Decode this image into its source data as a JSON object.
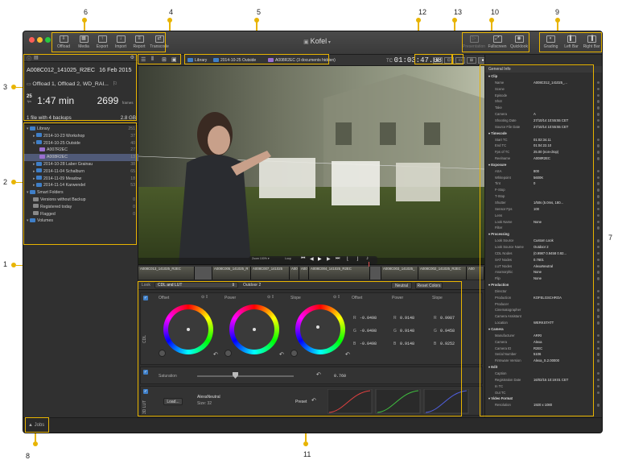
{
  "app": {
    "title": "Kofel"
  },
  "toolbar_left": [
    {
      "label": "Offload",
      "icon": "offload-icon"
    },
    {
      "label": "Media",
      "icon": "media-icon"
    },
    {
      "label": "Export",
      "icon": "export-icon"
    },
    {
      "label": "Import",
      "icon": "import-icon"
    },
    {
      "label": "Report",
      "icon": "report-icon"
    },
    {
      "label": "Transcode",
      "icon": "transcode-icon"
    }
  ],
  "toolbar_right": [
    {
      "label": "Presentation",
      "icon": "presentation-icon"
    },
    {
      "label": "Fullscreen",
      "icon": "fullscreen-icon"
    },
    {
      "label": "Quicklook",
      "icon": "quicklook-icon"
    },
    {
      "label": "Grading",
      "icon": "grading-icon"
    },
    {
      "label": "Left Bar",
      "icon": "left-bar-icon"
    },
    {
      "label": "Right Bar",
      "icon": "right-bar-icon"
    }
  ],
  "clip_info": {
    "name": "A008C012_141025_R2EC",
    "date": "16 Feb 2015",
    "offload": "Offload 1, Offload 2, WD_RAI...",
    "fps": "25",
    "fps_unit": "fps",
    "duration": "1:47 min",
    "frames": "2699",
    "frames_unit": "frames",
    "backups": "1 file with 4 backups",
    "size": "2.8 GB"
  },
  "library": [
    {
      "label": "Library",
      "count": "251",
      "level": 0,
      "type": "folder"
    },
    {
      "label": "2014-10-23 Workshop",
      "count": "37",
      "level": 1,
      "type": "folder"
    },
    {
      "label": "2014-10-25 Outside",
      "count": "40",
      "level": 1,
      "type": "folder"
    },
    {
      "label": "A007R2EC",
      "count": "27",
      "level": 2,
      "type": "clipfolder"
    },
    {
      "label": "A008R2EC",
      "count": "13",
      "level": 2,
      "type": "clipfolder",
      "selected": true
    },
    {
      "label": "2014-10-28 Laber Grainau",
      "count": "38",
      "level": 1,
      "type": "folder"
    },
    {
      "label": "2014-11-04 Schalburn",
      "count": "65",
      "level": 1,
      "type": "folder"
    },
    {
      "label": "2014-11-09 Meadow",
      "count": "18",
      "level": 1,
      "type": "folder"
    },
    {
      "label": "2014-11-14 Karwendel",
      "count": "53",
      "level": 1,
      "type": "folder"
    },
    {
      "label": "Smart Folders",
      "count": "",
      "level": 0,
      "type": "folder"
    },
    {
      "label": "Versions without Backup",
      "count": "0",
      "level": 1,
      "type": "smart"
    },
    {
      "label": "Registered today",
      "count": "0",
      "level": 1,
      "type": "smart"
    },
    {
      "label": "Flagged",
      "count": "0",
      "level": 1,
      "type": "smart"
    },
    {
      "label": "Volumes",
      "count": "",
      "level": 0,
      "type": "folder"
    }
  ],
  "breadcrumb": [
    "Library",
    "2014-10-25 Outside",
    "A008R2EC (3 documents hidden)"
  ],
  "timecode": "01:03:47.08",
  "inspector": {
    "tab_title": "General Info",
    "rows": [
      {
        "k": "Clip",
        "h": true
      },
      {
        "k": "Name",
        "v": "A008C012_141025_..."
      },
      {
        "k": "Scene",
        "v": ""
      },
      {
        "k": "Episode",
        "v": ""
      },
      {
        "k": "Shot",
        "v": ""
      },
      {
        "k": "Take",
        "v": ""
      },
      {
        "k": "Camera",
        "v": "A"
      },
      {
        "k": "Shooting Date",
        "v": "27/10/14 10:55:55 CET"
      },
      {
        "k": "Source File Date",
        "v": "27/10/14 10:55:55 CET"
      },
      {
        "k": "Timecode",
        "h": true
      },
      {
        "k": "Start TC",
        "v": "01:02:34.11"
      },
      {
        "k": "End TC",
        "v": "01:04:22.10"
      },
      {
        "k": "Fps of TC",
        "v": "25.00 (non-drop)"
      },
      {
        "k": "Reelname",
        "v": "A008R2EC"
      },
      {
        "k": "Exposure",
        "h": true
      },
      {
        "k": "ASA",
        "v": "800"
      },
      {
        "k": "Whitepoint",
        "v": "5600K"
      },
      {
        "k": "Tint",
        "v": "0"
      },
      {
        "k": "F-Stop",
        "v": ""
      },
      {
        "k": "T-Stop",
        "v": ""
      },
      {
        "k": "Shutter",
        "v": "1/50s (5.0ms, 180..."
      },
      {
        "k": "Sensor Fps",
        "v": "100"
      },
      {
        "k": "Lens",
        "v": ""
      },
      {
        "k": "Look Name",
        "v": "None"
      },
      {
        "k": "Filter",
        "v": ""
      },
      {
        "k": "Processing",
        "h": true
      },
      {
        "k": "Look Source",
        "v": "Custom Look"
      },
      {
        "k": "Look Source Name",
        "v": "Outdoor 2"
      },
      {
        "k": "CDL Nodes",
        "v": "(0.9987 0.9458 0.92..."
      },
      {
        "k": "SAT Nodes",
        "v": "0.7601"
      },
      {
        "k": "LUT Nodes",
        "v": "AlexaNeutral"
      },
      {
        "k": "Anamorphic",
        "v": "None"
      },
      {
        "k": "Flip",
        "v": "None"
      },
      {
        "k": "Production",
        "h": true
      },
      {
        "k": "Director",
        "v": ""
      },
      {
        "k": "Production",
        "v": "KOFELGSCHROA"
      },
      {
        "k": "Producer",
        "v": ""
      },
      {
        "k": "Cinematographer",
        "v": ""
      },
      {
        "k": "Camera Assistant",
        "v": ""
      },
      {
        "k": "Location",
        "v": "WERKSTATT"
      },
      {
        "k": "Camera",
        "h": true
      },
      {
        "k": "Manufacturer",
        "v": "ARRI"
      },
      {
        "k": "Camera",
        "v": "Alexa"
      },
      {
        "k": "Camera ID",
        "v": "R2EC"
      },
      {
        "k": "Serial Number",
        "v": "5106"
      },
      {
        "k": "Firmware Version",
        "v": "Alexa_S.2.00000"
      },
      {
        "k": "Edit",
        "h": true
      },
      {
        "k": "Caption",
        "v": ""
      },
      {
        "k": "Registration Date",
        "v": "16/02/15 10:19:01 CET"
      },
      {
        "k": "In TC",
        "v": ""
      },
      {
        "k": "Out TC",
        "v": ""
      },
      {
        "k": "Video Format",
        "h": true
      },
      {
        "k": "Resolution",
        "v": "1920 x 1080"
      }
    ]
  },
  "filmstrip": [
    "A008C013_141025_R2EC",
    "",
    "A008C005_141025_R",
    "A008C007_141025",
    "A00",
    "A00",
    "A008C004_141025_R2EC",
    "",
    "A008C003_141025_",
    "A008C002_141025_R2EC",
    "A00"
  ],
  "grading": {
    "look_label": "Look",
    "look_value": "CDL and LUT",
    "preset_name": "Outdoor 2",
    "neutral_label": "Neutral",
    "reset_label": "Reset Colors",
    "wheels": [
      {
        "label": "Offset",
        "r": "-0.0498",
        "g": "-0.0498",
        "b": "-0.0498"
      },
      {
        "label": "Power",
        "r": "0.9148",
        "g": "0.9148",
        "b": "0.9148"
      },
      {
        "label": "Slope",
        "r": "0.9987",
        "g": "0.9458",
        "b": "0.9252"
      }
    ],
    "cdl_label": "CDL",
    "saturation_label": "Saturation",
    "saturation_value": "0.760",
    "lut_label": "3D LUT",
    "load_label": "Load...",
    "lut_name": "AlexaNeutral",
    "lut_size": "Size: 32",
    "preset_label": "Preset"
  },
  "jobs_label": "Jobs",
  "callouts": [
    "1",
    "2",
    "3",
    "4",
    "5",
    "6",
    "7",
    "8",
    "9",
    "10",
    "11",
    "12",
    "13"
  ],
  "colors": {
    "accent": "#e8b400",
    "selection": "#505a78",
    "folder": "#3f7fc8"
  }
}
